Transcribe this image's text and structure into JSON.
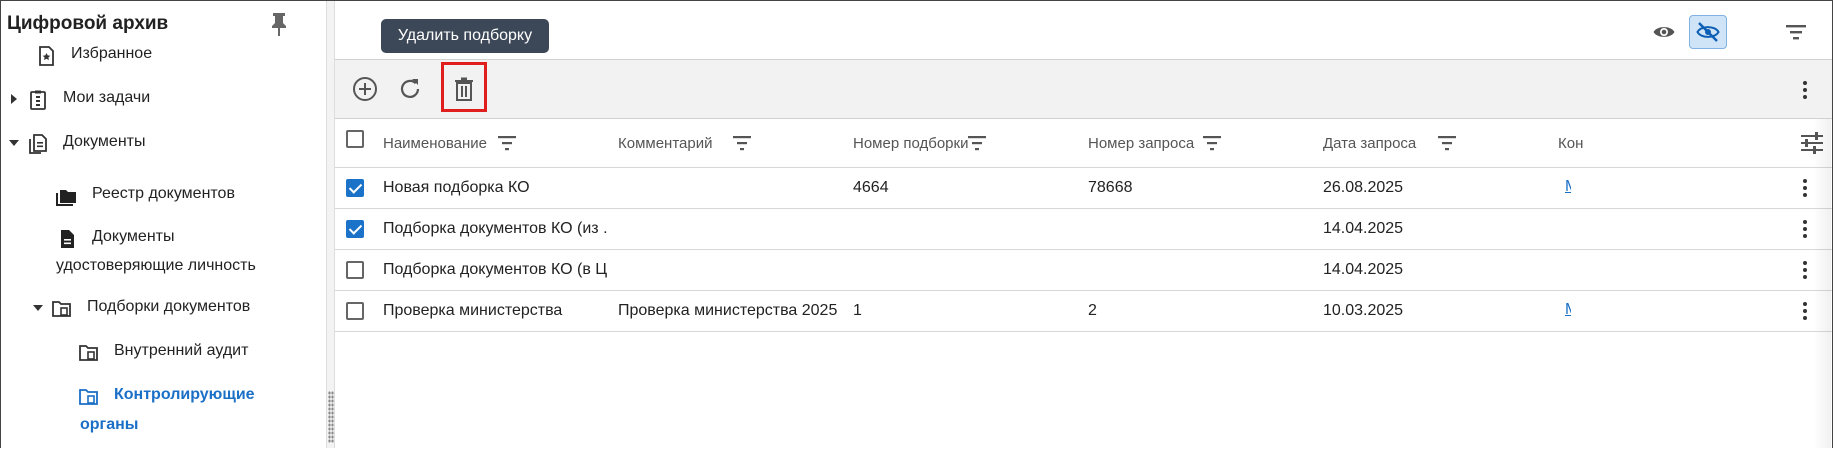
{
  "app": {
    "title": "Цифровой архив"
  },
  "sidebar": {
    "items": [
      {
        "label": "Избранное"
      },
      {
        "label": "Мои задачи"
      },
      {
        "label": "Документы"
      },
      {
        "label": "Реестр документов"
      },
      {
        "label_line1": "Документы",
        "label_line2": "удостоверяющие личность"
      },
      {
        "label": "Подборки документов"
      },
      {
        "label": "Внутренний аудит"
      },
      {
        "label_line1": "Контролирующие",
        "label_line2": "органы"
      }
    ]
  },
  "tooltip": {
    "text": "Удалить подборку"
  },
  "toolbar": {
    "add_icon": "add-circle-icon",
    "refresh_icon": "refresh-icon",
    "delete_icon": "trash-icon"
  },
  "table": {
    "columns": [
      "Наименование",
      "Комментарий",
      "Номер подборки",
      "Номер запроса",
      "Дата запроса",
      "Кон"
    ],
    "rows": [
      {
        "checked": true,
        "name": "Новая подборка КО",
        "comment": "",
        "selection_no": "4664",
        "request_no": "78668",
        "request_date": "26.08.2025",
        "has_link": true
      },
      {
        "checked": true,
        "name": "Подборка документов КО (из ...",
        "comment": "",
        "selection_no": "",
        "request_no": "",
        "request_date": "14.04.2025",
        "has_link": false
      },
      {
        "checked": false,
        "name": "Подборка документов КО (в Ц...",
        "comment": "",
        "selection_no": "",
        "request_no": "",
        "request_date": "14.04.2025",
        "has_link": false
      },
      {
        "checked": false,
        "name": "Проверка министерства",
        "comment": "Проверка министерства 2025",
        "selection_no": "1",
        "request_no": "2",
        "request_date": "10.03.2025",
        "has_link": true
      }
    ],
    "link_stub": "М"
  },
  "colors": {
    "accent": "#1a73c9",
    "highlight": "#e01e1e",
    "tooltip_bg": "#3c4857",
    "active_nav": "#1a6fc6"
  }
}
